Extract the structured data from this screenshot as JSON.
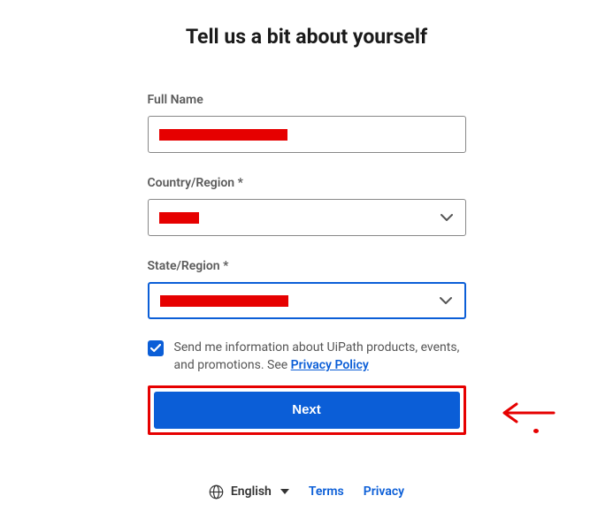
{
  "page": {
    "title": "Tell us a bit about yourself"
  },
  "form": {
    "fullname": {
      "label": "Full Name",
      "value": ""
    },
    "country": {
      "label": "Country/Region *",
      "value": ""
    },
    "state": {
      "label": "State/Region *",
      "value": ""
    },
    "marketing": {
      "checked": true,
      "text_before": "Send me information about UiPath products, events, and promotions. See ",
      "link_label": "Privacy Policy"
    },
    "next_label": "Next"
  },
  "footer": {
    "language": "English",
    "terms": "Terms",
    "privacy": "Privacy"
  }
}
